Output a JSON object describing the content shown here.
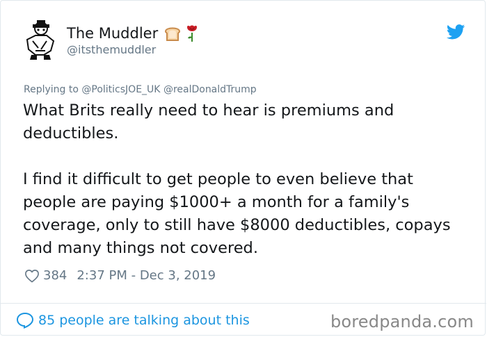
{
  "tweet": {
    "display_name": "The Muddler",
    "handle": "@itsthemuddler",
    "name_emojis": [
      "bread-icon",
      "rose-icon"
    ],
    "replying_prefix": "Replying to",
    "replying_to": [
      "@PoliticsJOE_UK",
      "@realDonaldTrump"
    ],
    "paragraphs": [
      "What Brits really need to hear is premiums and deductibles.",
      "I find it difficult to get people to even believe that people are paying $1000+ a month for a family's coverage, only to still have $8000 deductibles, copays and many things not covered."
    ],
    "likes": "384",
    "timestamp": "2:37 PM - Dec 3, 2019",
    "talking": "85 people are talking about this"
  },
  "watermark": "boredpanda.com",
  "colors": {
    "link_blue": "#1b95e0",
    "twitter_blue": "#1da1f2",
    "muted": "#657786"
  }
}
